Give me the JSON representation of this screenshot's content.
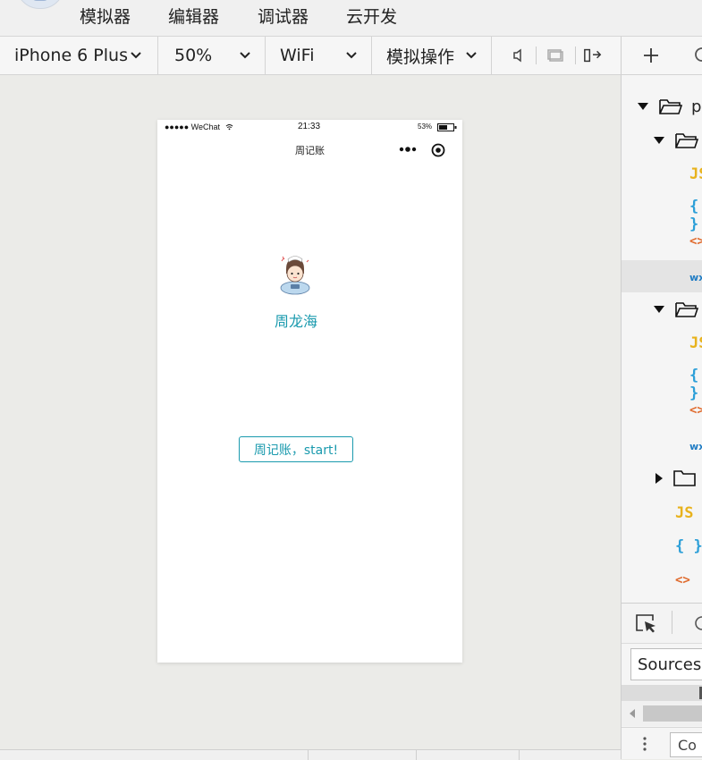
{
  "menubar": {
    "items": [
      "模拟器",
      "编辑器",
      "调试器",
      "云开发"
    ]
  },
  "toolbar": {
    "device": "iPhone 6 Plus",
    "zoom": "50%",
    "network": "WiFi",
    "operations": "模拟操作"
  },
  "phone": {
    "status": {
      "carrier": "●●●●● WeChat",
      "time": "21:33",
      "battery": "53%"
    },
    "nav_title": "周记账",
    "nickname": "周龙海",
    "start_button": "周记账，start!"
  },
  "file_tree": {
    "root_name": "pa"
  },
  "devtools": {
    "sources_tab": "Sources",
    "console_input": "Co"
  },
  "colors": {
    "accent": "#1a9aae",
    "js": "#e8b21c",
    "json": "#2c9fd8",
    "wxml": "#e06a2c"
  }
}
